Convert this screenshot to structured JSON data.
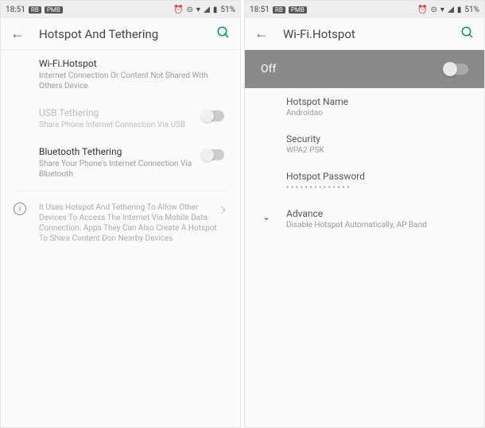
{
  "statusbar": {
    "time": "18:51",
    "badge1": "RB",
    "badge2": "PMB",
    "battery": "51%"
  },
  "left": {
    "title": "Hotspot And Tethering",
    "wifi": {
      "title": "Wi-Fi.Hotspot",
      "sub": "Internet Connection Or Content Not Shared With Others Device"
    },
    "usb": {
      "title": "USB Tethering",
      "sub": "Share Phone Internet Connection Via USB"
    },
    "bt": {
      "title": "Bluetooth Tethering",
      "sub": "Share Your Phone's Internet Connection Via Bluetooth"
    },
    "info": "It Uses Hotspot And Tethering To Allow Other Devices To Access The Internet Via Mobile Data Connection. Apps They Can Also Create A Hotspot To Share Content Don Nearby Devices"
  },
  "right": {
    "title": "Wi-Fi.Hotspot",
    "banner": "Off",
    "name": {
      "title": "Hotspot Name",
      "value": "Androidao"
    },
    "security": {
      "title": "Security",
      "value": "WPA2 PSK"
    },
    "password": {
      "title": "Hotspot Password",
      "value": "• • • • • • • • • • • • • •"
    },
    "advance": {
      "title": "Advance",
      "sub": "Disable Hotspot Automatically, AP Band"
    }
  }
}
